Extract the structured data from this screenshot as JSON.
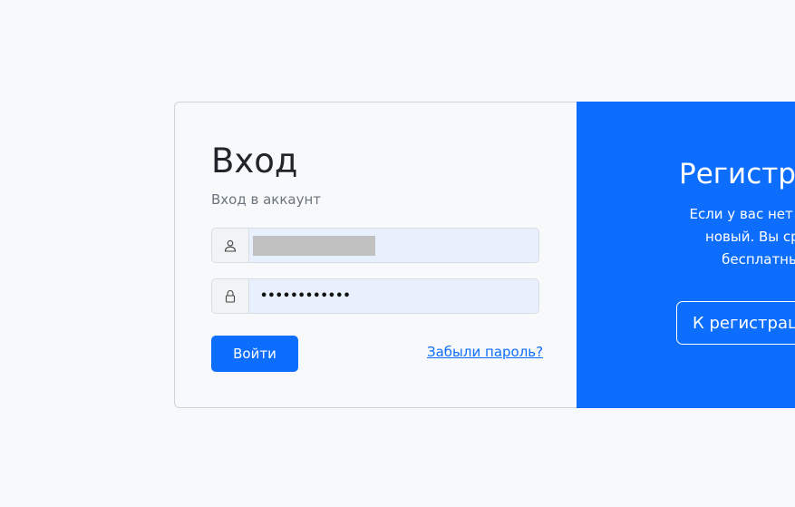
{
  "login": {
    "title": "Вход",
    "subtitle": "Вход в аккаунт",
    "username_value": "",
    "password_mask": "••••••••••••",
    "submit_label": "Войти",
    "forgot_label": "Забыли пароль?"
  },
  "register": {
    "title": "Регистра",
    "text_lines": [
      "Если у вас нет аккаунта, пр",
      "новый. Вы сразу сможе",
      "бесплатный тест н"
    ],
    "button_label": "К регистрац"
  },
  "icons": {
    "user": "user-icon",
    "lock": "lock-icon"
  },
  "colors": {
    "accent": "#0d6efd",
    "input_bg": "#e8f0fe"
  }
}
